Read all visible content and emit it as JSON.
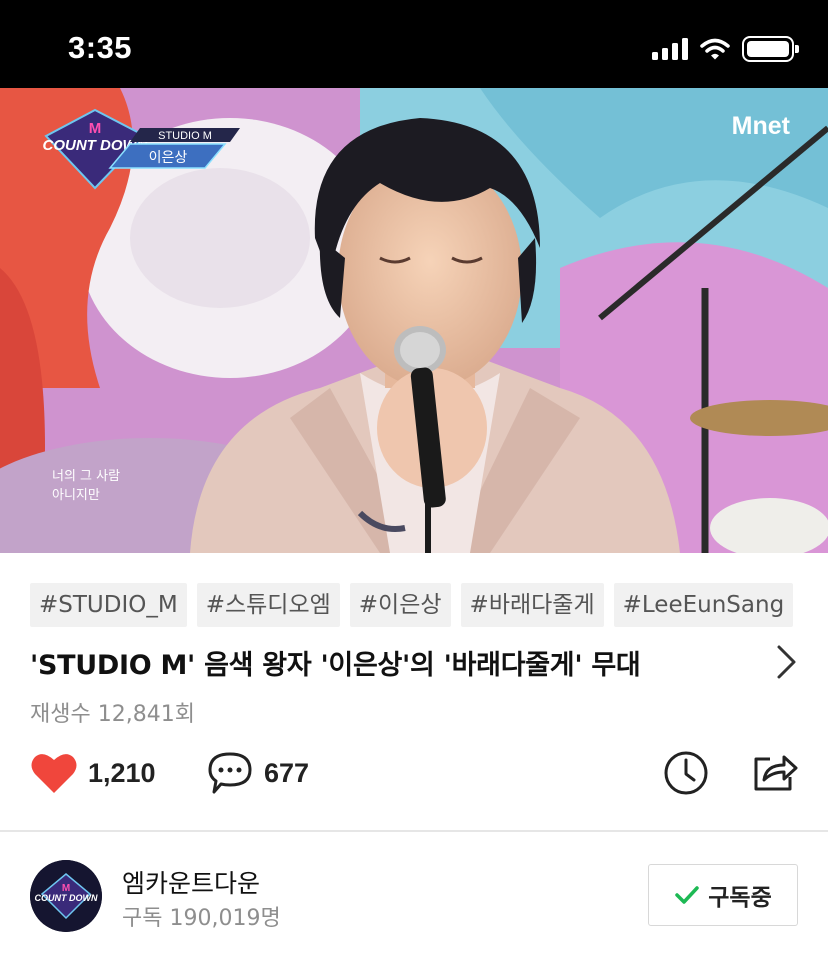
{
  "status_bar": {
    "time": "3:35"
  },
  "video": {
    "show_badge": {
      "logo": "COUNT DOWN",
      "segment": "STUDIO M",
      "artist": "이은상"
    },
    "broadcaster_logo": "Mnet",
    "lyrics": [
      "너의 그 사람",
      "아니지만"
    ]
  },
  "tags": [
    "#STUDIO_M",
    "#스튜디오엠",
    "#이은상",
    "#바래다줄게",
    "#LeeEunSang"
  ],
  "title": "'STUDIO M' 음색 왕자 '이은상'의 '바래다줄게' 무대",
  "views": "재생수 12,841회",
  "actions": {
    "likes": "1,210",
    "comments": "677"
  },
  "channel": {
    "name": "엠카운트다운",
    "subscribers": "구독 190,019명",
    "subscribe_label": "구독중"
  },
  "colors": {
    "heart": "#f0463c",
    "check": "#1db954"
  },
  "icons": [
    "signal-icon",
    "wifi-icon",
    "battery-icon",
    "chevron-right-icon",
    "heart-icon",
    "comment-icon",
    "clock-icon",
    "share-icon",
    "check-icon"
  ]
}
